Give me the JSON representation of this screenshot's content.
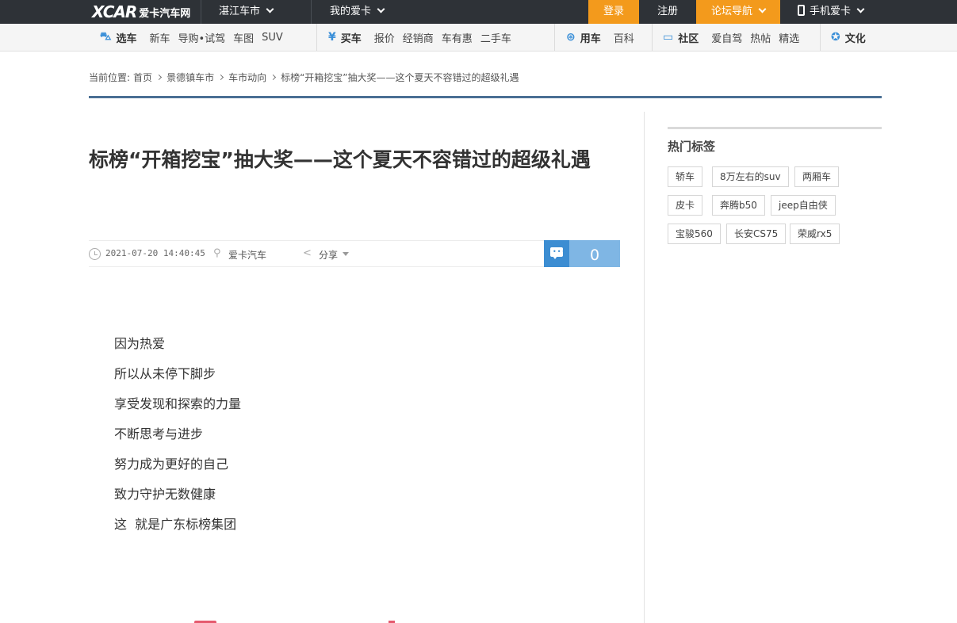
{
  "topbar": {
    "logo_mark": "XCAR",
    "logo_name": "爱卡汽车网",
    "city": "湛江车市",
    "my_xcar": "我的爱卡",
    "login": "登录",
    "register": "注册",
    "forum_nav": "论坛导航",
    "mobile": "手机爱卡"
  },
  "nav": {
    "select": {
      "head": "选车",
      "links": [
        "新车",
        "导购•试驾",
        "车图",
        "SUV"
      ]
    },
    "buy": {
      "head": "买车",
      "links": [
        "报价",
        "经销商",
        "车有惠",
        "二手车"
      ]
    },
    "use": {
      "head": "用车",
      "links": [
        "百科"
      ]
    },
    "community": {
      "head": "社区",
      "links": [
        "爱自驾",
        "热帖",
        "精选"
      ]
    },
    "culture": {
      "head": "文化"
    }
  },
  "breadcrumb": {
    "prefix": "当前位置:",
    "items": [
      "首页",
      "景德镇车市",
      "车市动向",
      "标榜“开箱挖宝”抽大奖——这个夏天不容错过的超级礼遇"
    ]
  },
  "article": {
    "title": "标榜“开箱挖宝”抽大奖——这个夏天不容错过的超级礼遇",
    "date": "2021-07-20 14:40:45",
    "source": "爱卡汽车",
    "share": "分享",
    "comment_count": "0",
    "paragraphs": [
      "因为热爱",
      "所以从未停下脚步",
      "享受发现和探索的力量",
      "不断思考与进步",
      "努力成为更好的自己",
      "致力守护无数健康",
      "这  就是广东标榜集团"
    ]
  },
  "sidebar": {
    "title": "热门标签",
    "tags": [
      "轿车",
      "8万左右的suv",
      "两厢车",
      "皮卡",
      "奔腾b50",
      "jeep自由侠",
      "宝骏560",
      "长安CS75",
      "荣威rx5"
    ]
  },
  "colors": {
    "topbar": "#2e3237",
    "accent_orange": "#f39a1c",
    "accent_blue": "#3c8dd2",
    "crumb_line": "#4a6f94"
  }
}
